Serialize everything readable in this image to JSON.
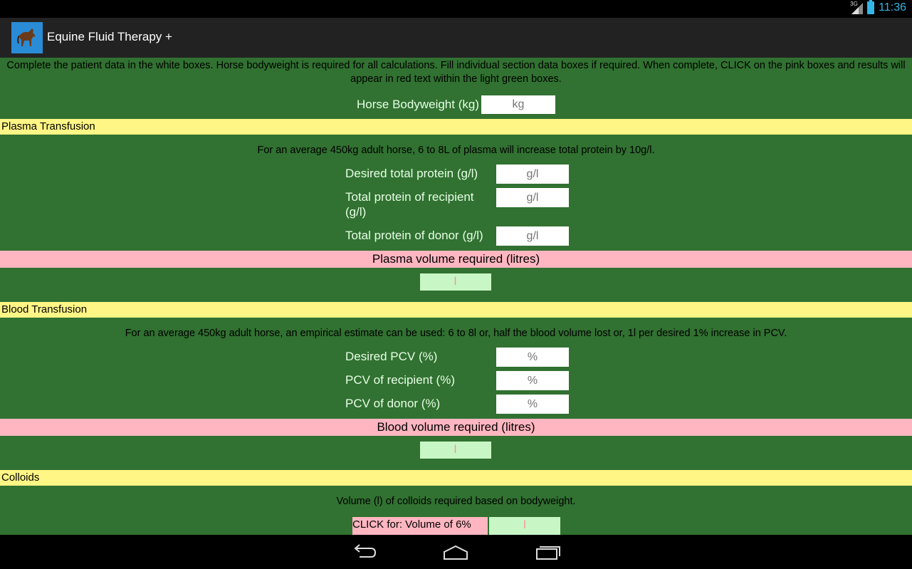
{
  "status": {
    "network": "3G",
    "time": "11:36"
  },
  "app": {
    "title": "Equine Fluid Therapy +"
  },
  "intro": "Complete the patient data in the white boxes. Horse bodyweight is required for all calculations. Fill individual section data boxes if required. When complete, CLICK on the pink boxes and results will appear in red text within the light green boxes.",
  "bodyweight": {
    "label": "Horse Bodyweight (kg)",
    "placeholder": "kg"
  },
  "plasma": {
    "header": "Plasma Transfusion",
    "desc": "For an average 450kg adult horse, 6 to 8L of plasma will increase total protein by 10g/l.",
    "fields": [
      {
        "label": "Desired total protein (g/l)",
        "placeholder": "g/l"
      },
      {
        "label": "Total protein of recipient (g/l)",
        "placeholder": "g/l"
      },
      {
        "label": "Total protein of donor (g/l)",
        "placeholder": "g/l"
      }
    ],
    "calc_label": "Plasma volume required (litres)",
    "result_unit": "l"
  },
  "blood": {
    "header": "Blood Transfusion",
    "desc": "For an average 450kg adult horse, an empirical estimate can be used: 6 to 8l or, half the blood volume lost or, 1l per desired 1% increase in PCV.",
    "fields": [
      {
        "label": "Desired PCV (%)",
        "placeholder": "%"
      },
      {
        "label": "PCV of recipient (%)",
        "placeholder": "%"
      },
      {
        "label": "PCV of donor (%)",
        "placeholder": "%"
      }
    ],
    "calc_label": "Blood volume required (litres)",
    "result_unit": "l"
  },
  "colloids": {
    "header": "Colloids",
    "desc": "Volume (l) of colloids required based on bodyweight.",
    "calc_label": "CLICK for: Volume of 6%",
    "result_unit": "l"
  },
  "colors": {
    "background": "#317131",
    "section_header": "#fff685",
    "calc_button": "#ffb6c1",
    "result_box": "#c8f7c5",
    "status_accent": "#33b5e5"
  },
  "icons": {
    "app": "horse-icon",
    "back": "back-icon",
    "home": "home-icon",
    "recents": "recents-icon"
  }
}
